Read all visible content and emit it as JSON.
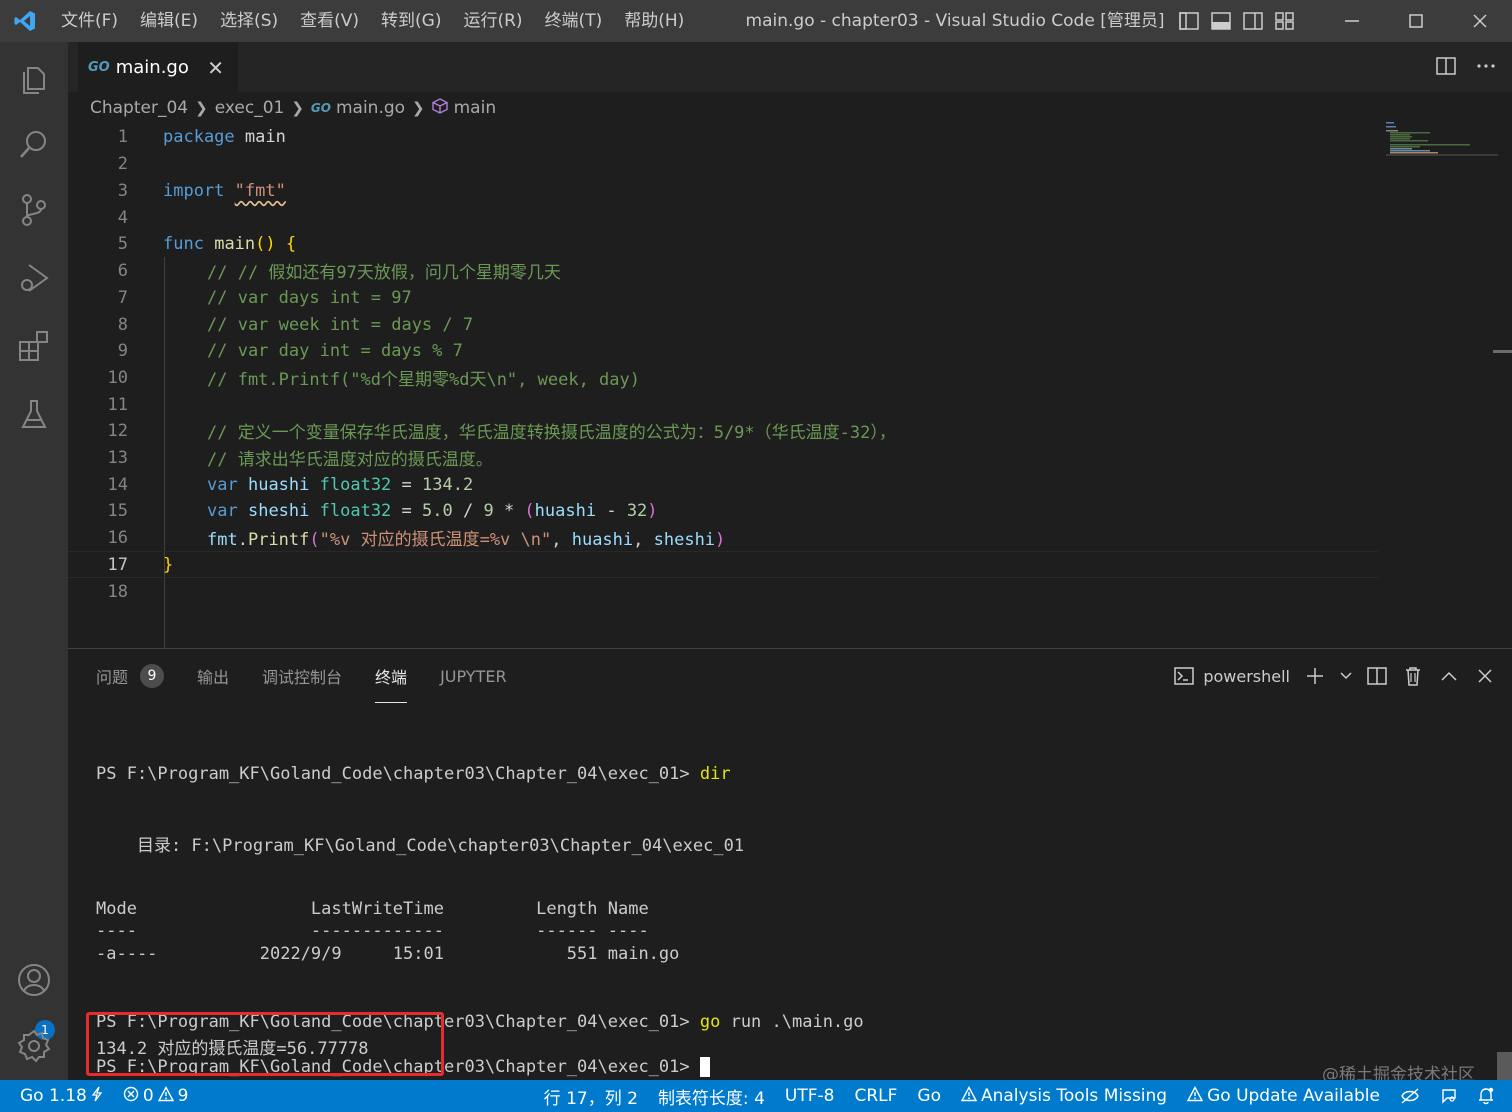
{
  "window": {
    "title": "main.go - chapter03 - Visual Studio Code [管理员]",
    "menu": [
      "文件(F)",
      "编辑(E)",
      "选择(S)",
      "查看(V)",
      "转到(G)",
      "运行(R)",
      "终端(T)",
      "帮助(H)"
    ]
  },
  "activity": {
    "accounts_badge": "1"
  },
  "editor": {
    "tab": {
      "icon_text": "GO",
      "label": "main.go",
      "close": "✕"
    },
    "breadcrumb": {
      "folder1": "Chapter_04",
      "folder2": "exec_01",
      "file": "main.go",
      "symbol": "main"
    },
    "line_numbers": [
      "1",
      "2",
      "3",
      "4",
      "5",
      "6",
      "7",
      "8",
      "9",
      "10",
      "11",
      "12",
      "13",
      "14",
      "15",
      "16",
      "17",
      "18"
    ],
    "code": {
      "l1_kw": "package",
      "l1_name": "main",
      "l3_kw": "import",
      "l3_str": "\"fmt\"",
      "l5_kw": "func",
      "l5_fn": "main",
      "l5_rest": "() ",
      "l5_brace": "{",
      "l6": "// // 假如还有97天放假，问几个星期零几天",
      "l7": "// var days int = 97",
      "l8": "// var week int = days / 7",
      "l9": "// var day int = days % 7",
      "l10": "// fmt.Printf(\"%d个星期零%d天\\n\", week, day)",
      "l12": "// 定义一个变量保存华氏温度，华氏温度转换摄氏温度的公式为：5/9*（华氏温度-32），",
      "l13": "// 请求出华氏温度对应的摄氏温度。",
      "l14_kw": "var",
      "l14_var": "huashi",
      "l14_ty": "float32",
      "l14_eq": " = ",
      "l14_num": "134.2",
      "l15_kw": "var",
      "l15_var": "sheshi",
      "l15_ty": "float32",
      "l15_eq": " = ",
      "l15_n1": "5.0",
      "l15_op": " / ",
      "l15_n2": "9",
      "l15_op2": " * ",
      "l15_p1": "(",
      "l15_v": "huashi",
      "l15_minus": " - ",
      "l15_n3": "32",
      "l15_p2": ")",
      "l16_pkg": "fmt",
      "l16_dot": ".",
      "l16_fn": "Printf",
      "l16_p1": "(",
      "l16_str": "\"%v 对应的摄氏温度=%v \\n\"",
      "l16_comma": ", ",
      "l16_v1": "huashi",
      "l16_comma2": ", ",
      "l16_v2": "sheshi",
      "l16_p2": ")",
      "l17": "}"
    }
  },
  "panel": {
    "tabs": [
      {
        "label": "问题",
        "count": "9"
      },
      {
        "label": "输出"
      },
      {
        "label": "调试控制台"
      },
      {
        "label": "终端"
      },
      {
        "label": "JUPYTER"
      }
    ],
    "shell": "powershell",
    "terminal": {
      "l1_prompt": "PS F:\\Program_KF\\Goland_Code\\chapter03\\Chapter_04\\exec_01> ",
      "l1_cmd": "dir",
      "l2": "    目录: F:\\Program_KF\\Goland_Code\\chapter03\\Chapter_04\\exec_01",
      "l3": "Mode                 LastWriteTime         Length Name",
      "l4": "----                 -------------         ------ ----",
      "l5": "-a----          2022/9/9     15:01            551 main.go",
      "l6_prompt": "PS F:\\Program_KF\\Goland_Code\\chapter03\\Chapter_04\\exec_01> ",
      "l6_cmd": "go",
      "l6_args": " run .\\main.go",
      "l7": "134.2 对应的摄氏温度=56.77778",
      "l8_prompt": "PS F:\\Program_KF\\Goland_Code\\chapter03\\Chapter_04\\exec_01> "
    },
    "watermark": "@稀土掘金技术社区"
  },
  "statusbar": {
    "go_version": "Go 1.18",
    "errors": "0",
    "warnings": "9",
    "position": "行 17，列 2",
    "indent": "制表符长度: 4",
    "encoding": "UTF-8",
    "eol": "CRLF",
    "language": "Go",
    "analysis": "Analysis Tools Missing",
    "update": "Go Update Available"
  },
  "colors": {
    "accent": "#007acc",
    "highlight_box": "#e52d2d"
  }
}
